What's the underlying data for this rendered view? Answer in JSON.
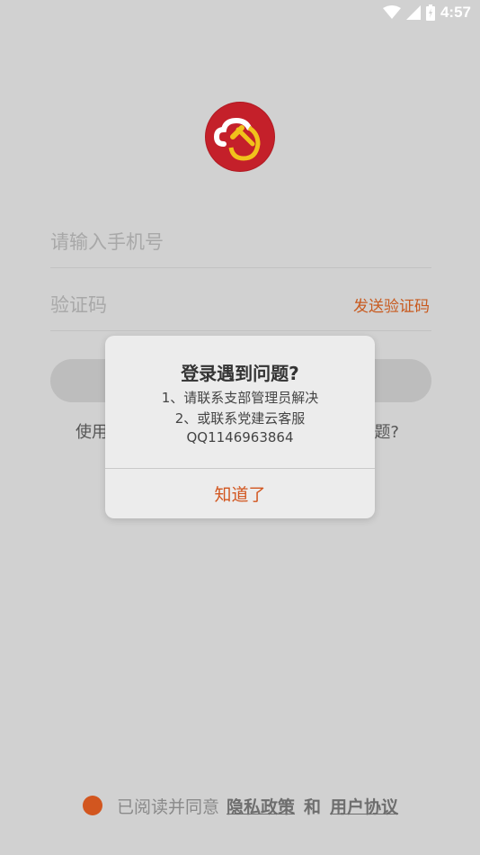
{
  "status_bar": {
    "time": "4:57"
  },
  "form": {
    "phone_placeholder": "请输入手机号",
    "code_placeholder": "验证码",
    "send_code": "发送验证码",
    "help_left": "使用",
    "help_right": "题?"
  },
  "agreement": {
    "prefix": "已阅读并同意",
    "privacy": "隐私政策",
    "and": "和",
    "terms": "用户协议"
  },
  "dialog": {
    "title": "登录遇到问题?",
    "lines": [
      "1、请联系支部管理员解决",
      "2、或联系党建云客服",
      "QQ1146963864"
    ],
    "ok_label": "知道了"
  },
  "colors": {
    "accent": "#d2561f",
    "logo_red": "#c4202a",
    "background": "#d1d1d1"
  }
}
